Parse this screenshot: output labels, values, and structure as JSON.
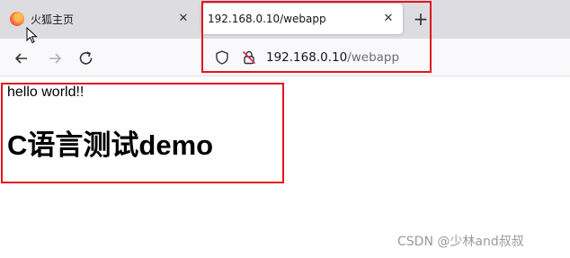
{
  "tabs": [
    {
      "title": "火狐主页",
      "active": false
    },
    {
      "title": "192.168.0.10/webapp",
      "active": true
    }
  ],
  "tab_close_glyph": "✕",
  "new_tab_glyph": "+",
  "toolbar": {
    "icons": [
      "back-arrow-icon",
      "forward-arrow-icon",
      "reload-icon"
    ]
  },
  "urlbar": {
    "host": "192.168.0.10",
    "path": "/webapp",
    "icons": [
      "shield-icon",
      "insecure-lock-icon"
    ]
  },
  "page": {
    "text": "hello world!!",
    "heading": "C语言测试demo"
  },
  "watermark": "CSDN @少林and叔叔",
  "colors": {
    "highlight": "#e5131d",
    "tabbar_bg": "#dddde1",
    "toolbar_bg": "#f9f9fb"
  }
}
